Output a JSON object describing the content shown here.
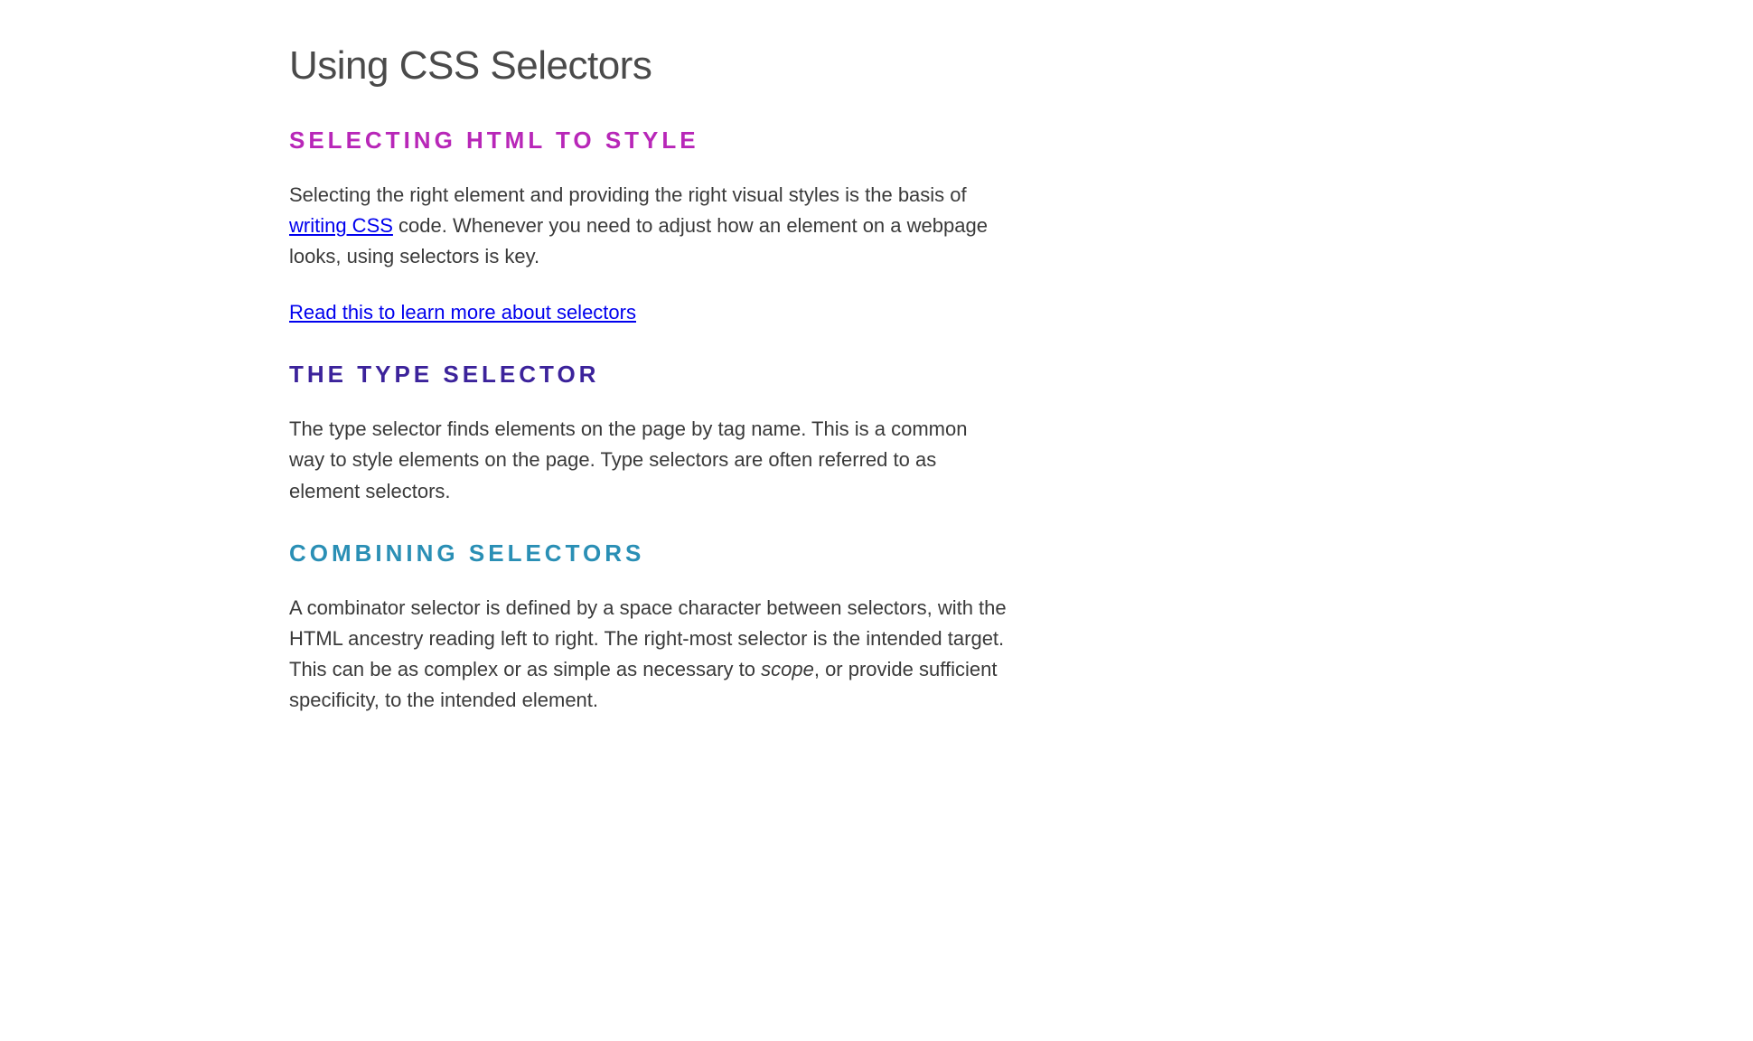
{
  "title": "Using CSS Selectors",
  "sections": [
    {
      "heading": "SELECTING HTML TO STYLE",
      "colorClass": "magenta",
      "paragraph_pre": "Selecting the right element and providing the right visual styles is the basis of ",
      "inline_link": "writing CSS",
      "paragraph_post": " code. Whenever you need to adjust how an element on a webpage looks, using selectors is key.",
      "standalone_link": "Read this to learn more about selectors"
    },
    {
      "heading": "THE TYPE SELECTOR",
      "colorClass": "purple",
      "paragraph": "The type selector finds elements on the page by tag name. This is a common way to style elements on the page. Type selectors are often referred to as element selectors."
    },
    {
      "heading": "COMBINING SELECTORS",
      "colorClass": "teal",
      "paragraph_pre": "A combinator selector is defined by a space character between selectors, with the HTML ancestry reading left to right. The right-most selector is the intended target. This can be as complex or as simple as necessary to ",
      "em_text": "scope",
      "paragraph_post": ", or provide sufficient specificity, to the intended element."
    }
  ]
}
